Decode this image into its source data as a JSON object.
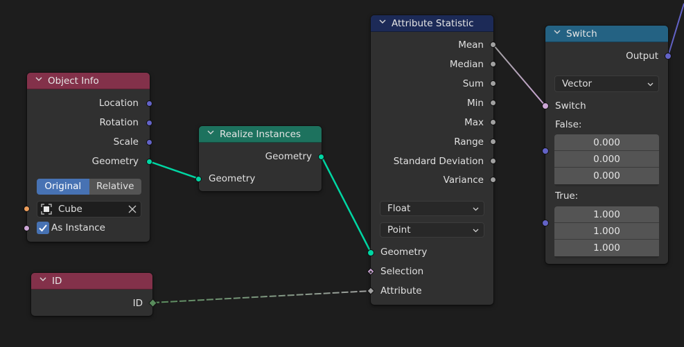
{
  "colors": {
    "background": "#1d1d1d",
    "node_body": "#303030",
    "header_input": "#83314a",
    "header_geometry": "#1d725e",
    "header_attribute": "#1c2a57",
    "header_converter": "#246283",
    "socket_vector": "#6363c7",
    "socket_geometry": "#00d6a3",
    "socket_float": "#a1a1a1",
    "socket_boolean": "#cca6d6",
    "socket_object": "#ed9e5c",
    "socket_integer": "#598c5c",
    "accent_blue": "#4772b3"
  },
  "nodes": {
    "object_info": {
      "title": "Object Info",
      "outputs": [
        "Location",
        "Rotation",
        "Scale",
        "Geometry"
      ],
      "transform_space": {
        "options": [
          "Original",
          "Relative"
        ],
        "selected": "Original"
      },
      "object_field": {
        "value": "Cube",
        "icon": "object-cube-icon",
        "clear_icon": "close-icon"
      },
      "as_instance": {
        "label": "As Instance",
        "checked": true
      }
    },
    "realize_instances": {
      "title": "Realize Instances",
      "output": "Geometry",
      "input": "Geometry"
    },
    "attribute_statistic": {
      "title": "Attribute Statistic",
      "outputs": [
        "Mean",
        "Median",
        "Sum",
        "Min",
        "Max",
        "Range",
        "Standard Deviation",
        "Variance"
      ],
      "data_type": "Float",
      "domain": "Point",
      "inputs": [
        "Geometry",
        "Selection",
        "Attribute"
      ]
    },
    "switch": {
      "title": "Switch",
      "output": "Output",
      "type": "Vector",
      "switch_label": "Switch",
      "false_label": "False:",
      "false_values": [
        "0.000",
        "0.000",
        "0.000"
      ],
      "true_label": "True:",
      "true_values": [
        "1.000",
        "1.000",
        "1.000"
      ]
    },
    "id": {
      "title": "ID",
      "output": "ID"
    }
  }
}
